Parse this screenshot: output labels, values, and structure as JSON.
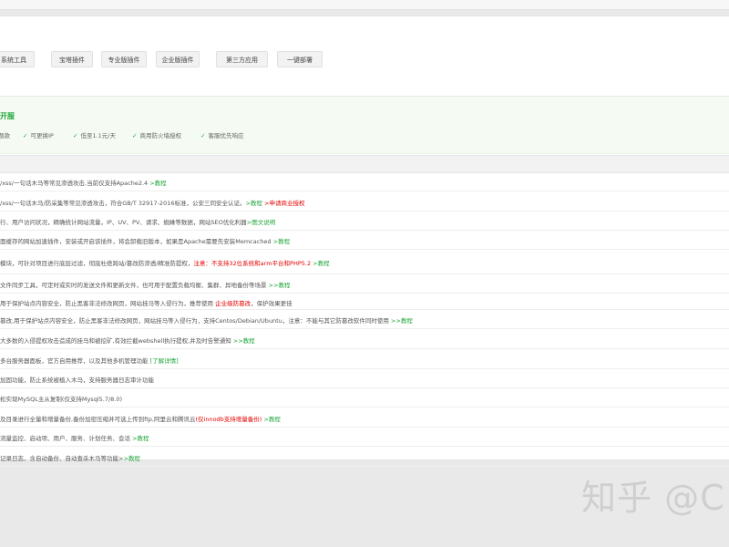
{
  "tabs": [
    {
      "label": "系统工具"
    },
    {
      "label": "宝塔插件"
    },
    {
      "label": "专业版插件"
    },
    {
      "label": "企业版插件"
    },
    {
      "label": "第三方应用"
    },
    {
      "label": "一键部署"
    }
  ],
  "promo": {
    "title": "开服",
    "features": [
      {
        "text": "题款"
      },
      {
        "text": "可更换IP"
      },
      {
        "text": "低至1.1元/天"
      },
      {
        "text": "商用防火墙授权"
      },
      {
        "text": "客服优先响应"
      }
    ]
  },
  "rows": [
    {
      "parts": [
        {
          "text": "/xss/一句话木马等常见渗透攻击,当前仅支持Apache2.4 ",
          "type": "plain"
        },
        {
          "text": ">教程",
          "type": "link"
        }
      ]
    },
    {
      "parts": [
        {
          "text": "/xss/一句话木马/防采集等常见渗透攻击，符合GB/T 32917-2016标准，公安三同安全认证。",
          "type": "plain"
        },
        {
          "text": ">教程",
          "type": "link"
        },
        {
          "text": " >申请商业授权",
          "type": "red"
        }
      ]
    },
    {
      "parts": [
        {
          "text": "行、用户访问状况，精确统计网站流量，IP、UV、PV、请求、蜘蛛等数据，网站SEO优化利器",
          "type": "plain"
        },
        {
          "text": ">图文说明",
          "type": "link"
        }
      ]
    },
    {
      "parts": [
        {
          "text": "面缓存的网站加速插件，安装或开启该插件，将会卸载旧版本，如果是Apache需要先安装Memcached ",
          "type": "plain"
        },
        {
          "text": ">教程",
          "type": "link"
        }
      ]
    },
    {
      "parts": [
        {
          "text": "模块，可针对项目进行底层过滤，彻底杜绝跨站/篡改防渗透/精准防提权，",
          "type": "plain"
        },
        {
          "text": "注意：不支持32位系统和arm平台和PHP5.2",
          "type": "red"
        },
        {
          "text": " >教程",
          "type": "link"
        }
      ]
    },
    {
      "parts": [
        {
          "text": "文件同步工具，可定时或实时的发送文件和更新文件，也可用于配置负载均衡、集群、异地备份等场景 ",
          "type": "plain"
        },
        {
          "text": ">>教程",
          "type": "link"
        }
      ]
    },
    {
      "parts": [
        {
          "text": "用于保护站点内容安全，防止黑客非法修改网页，网站挂马等入侵行为，推荐使用 ",
          "type": "plain"
        },
        {
          "text": "企业级防篡改",
          "type": "red"
        },
        {
          "text": "，保护效果更佳",
          "type": "plain"
        }
      ]
    },
    {
      "parts": [
        {
          "text": "篡改,用于保护站点内容安全，防止黑客非法修改网页，网站挂马等入侵行为，支持Centos/Debian/Ubuntu，注意：不能与其它防篡改软件同时使用 ",
          "type": "plain"
        },
        {
          "text": ">>教程",
          "type": "link"
        }
      ]
    },
    {
      "parts": [
        {
          "text": "大多数的入侵提权攻击造成的挂马和被挖矿,有效拦截webshell执行提权,并及时告警通知 ",
          "type": "plain"
        },
        {
          "text": ">>教程",
          "type": "link"
        }
      ]
    },
    {
      "parts": [
        {
          "text": "多台服务器面板，官方自用推荐，以及其他多机管理功能 ",
          "type": "plain"
        },
        {
          "text": "[了解详情]",
          "type": "link"
        }
      ]
    },
    {
      "parts": [
        {
          "text": "加固功能，防止系统被植入木马，支持服务器日志审计功能",
          "type": "plain"
        }
      ]
    },
    {
      "parts": [
        {
          "text": "松实现MySQL主从复制(仅支持Mysql5.7/8.0)",
          "type": "plain"
        }
      ]
    },
    {
      "parts": [
        {
          "text": "及目录进行全量和增量备份,备份加密压缩并可选上传到ftp,阿里云和腾讯云",
          "type": "plain"
        },
        {
          "text": "(仅innodb支持增量备份)",
          "type": "red"
        },
        {
          "text": " >教程",
          "type": "link"
        }
      ]
    },
    {
      "parts": [
        {
          "text": "流量监控、启动项、用户、服务、计划任务、会话 ",
          "type": "plain"
        },
        {
          "text": ">教程",
          "type": "link"
        }
      ]
    },
    {
      "parts": [
        {
          "text": "记录日志、含自动备份、自动查杀木马等功能>",
          "type": "plain"
        },
        {
          "text": ">教程",
          "type": "link"
        }
      ]
    }
  ],
  "watermark": "知乎 @C"
}
